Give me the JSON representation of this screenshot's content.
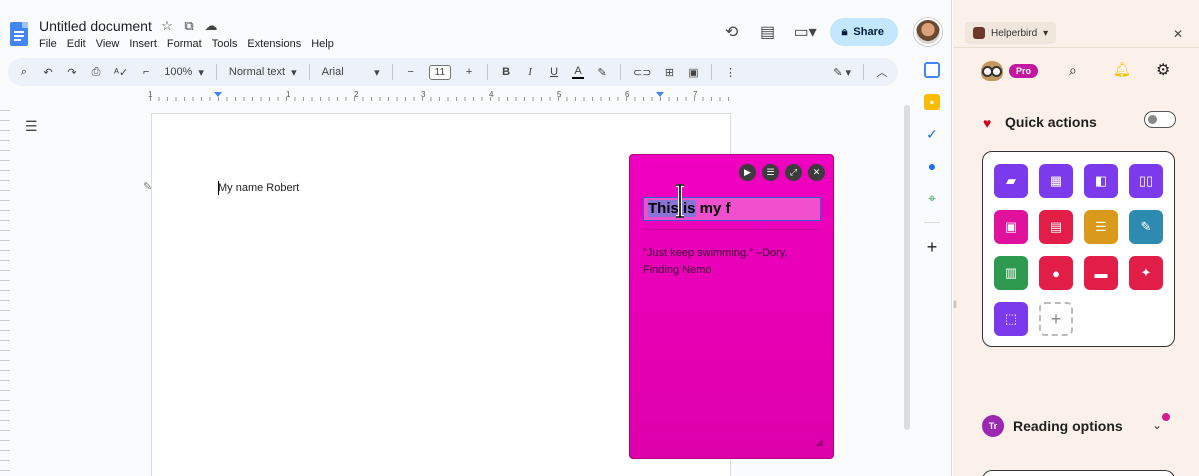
{
  "docs": {
    "title": "Untitled document",
    "menu": [
      "File",
      "Edit",
      "View",
      "Insert",
      "Format",
      "Tools",
      "Extensions",
      "Help"
    ],
    "share_label": "Share",
    "toolbar": {
      "zoom": "100%",
      "style": "Normal text",
      "font": "Arial",
      "size": "11"
    },
    "ruler_numbers": [
      "1",
      "1",
      "2",
      "3",
      "4",
      "5",
      "6",
      "7"
    ],
    "page_text": "My name Robert"
  },
  "sticky_note": {
    "title_selected": "This is",
    "title_rest": " my f",
    "body": "\"Just keep swimming.\" –Dory, Finding Nemo",
    "colors": {
      "bg": "#ee00bf",
      "border": "#b0007f"
    }
  },
  "helperbird": {
    "tab_label": "Helperbird",
    "pro_badge": "Pro",
    "quick_actions_title": "Quick actions",
    "quick_actions": [
      {
        "icon": "chat-icon",
        "color": "#7c3aed"
      },
      {
        "icon": "layout-icon",
        "color": "#7c3aed"
      },
      {
        "icon": "reader-icon",
        "color": "#7c3aed"
      },
      {
        "icon": "book-icon",
        "color": "#7c3aed"
      },
      {
        "icon": "pdf-icon",
        "color": "#e0119d"
      },
      {
        "icon": "document-icon",
        "color": "#e11d48"
      },
      {
        "icon": "form-icon",
        "color": "#d99a1b"
      },
      {
        "icon": "edit-doc-icon",
        "color": "#2e8bb0"
      },
      {
        "icon": "reading-book-icon",
        "color": "#2e9a4f"
      },
      {
        "icon": "microphone-icon",
        "color": "#e11d48"
      },
      {
        "icon": "note-icon",
        "color": "#e11d48"
      },
      {
        "icon": "sparkle-icon",
        "color": "#e11d48"
      },
      {
        "icon": "screenshot-icon",
        "color": "#7c3aed"
      }
    ],
    "reading_options_title": "Reading options",
    "reading_options_badge": "Tr"
  }
}
